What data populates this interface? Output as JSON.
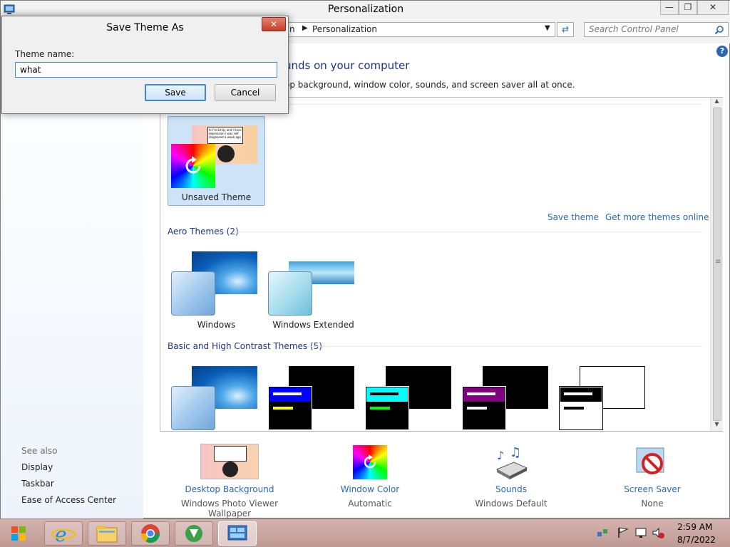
{
  "window": {
    "title": "Personalization",
    "buttons": {
      "minimize": "—",
      "maximize": "❐",
      "close": "✕"
    }
  },
  "address_bar": {
    "breadcrumb_prev": "n",
    "breadcrumb_current": "Personalization",
    "search_placeholder": "Search Control Panel"
  },
  "help_icon": "?",
  "heading": {
    "title_fragment": "unds on your computer",
    "subtitle_fragment": "op background, window color, sounds, and screen saver all at once."
  },
  "my_themes": {
    "unsaved_label": "Unsaved Theme",
    "meme_text": "hi I'm Emily and I have depression I was self diagnosed a week ago",
    "save_theme_link": "Save theme",
    "get_more_link": "Get more themes online"
  },
  "aero_section": {
    "title": "Aero Themes (2)",
    "themes": [
      {
        "label": "Windows"
      },
      {
        "label": "Windows Extended"
      }
    ]
  },
  "basic_section": {
    "title": "Basic and High Contrast Themes (5)"
  },
  "see_also": {
    "title": "See also",
    "links": [
      "Display",
      "Taskbar",
      "Ease of Access Center"
    ]
  },
  "bottom_bar": [
    {
      "link": "Desktop Background",
      "value": "Windows Photo Viewer Wallpaper",
      "icon": "desktop-background-icon"
    },
    {
      "link": "Window Color",
      "value": "Automatic",
      "icon": "window-color-icon"
    },
    {
      "link": "Sounds",
      "value": "Windows Default",
      "icon": "sounds-icon"
    },
    {
      "link": "Screen Saver",
      "value": "None",
      "icon": "screen-saver-icon"
    }
  ],
  "dialog": {
    "title": "Save Theme As",
    "close": "✕",
    "field_label": "Theme name:",
    "field_value": "what",
    "save_label": "Save",
    "cancel_label": "Cancel"
  },
  "taskbar": {
    "apps": [
      "start-orb",
      "internet-explorer-icon",
      "file-explorer-icon",
      "chrome-icon",
      "download-manager-icon",
      "control-panel-icon"
    ],
    "time": "2:59 AM",
    "date": "8/7/2022"
  },
  "colors": {
    "link_blue": "#2b67b2",
    "heading_blue": "#1e3287",
    "selection_bg": "#cfe3f8"
  }
}
